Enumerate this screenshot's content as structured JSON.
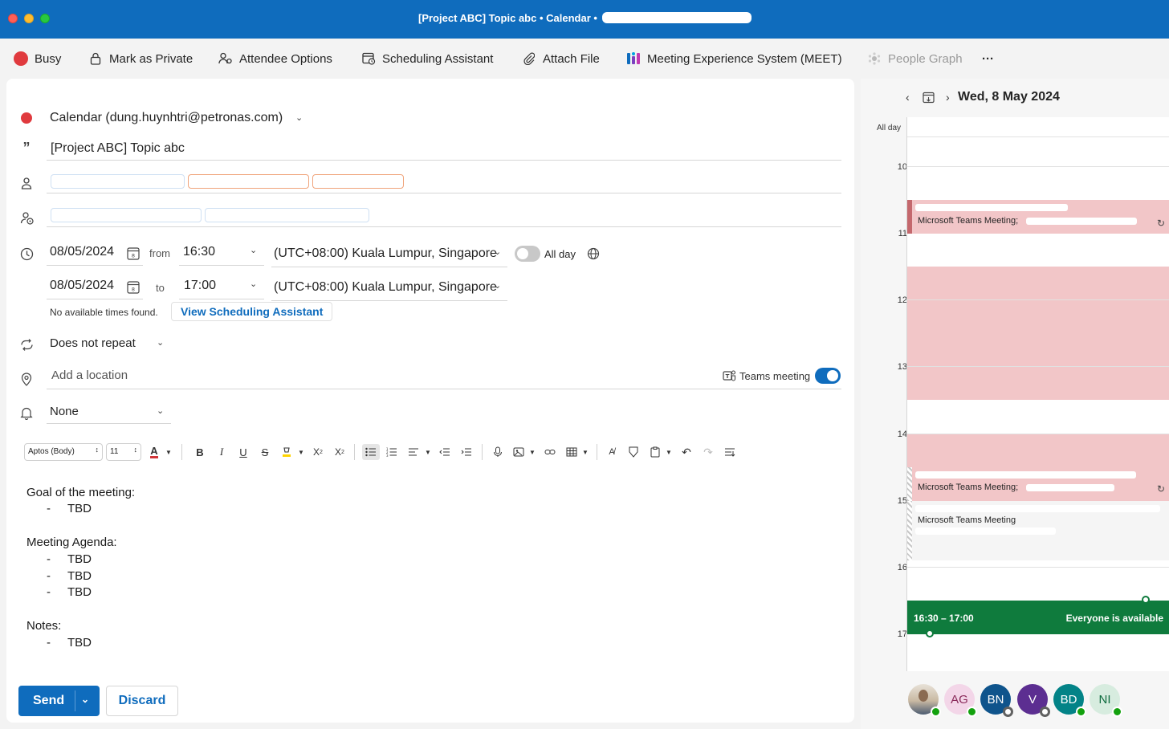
{
  "window": {
    "title": "[Project ABC] Topic abc • Calendar •"
  },
  "toolbar": {
    "busy": "Busy",
    "mark_private": "Mark as Private",
    "attendee_options": "Attendee Options",
    "scheduling_assistant": "Scheduling Assistant",
    "attach_file": "Attach File",
    "meet": "Meeting Experience System (MEET)",
    "people_graph": "People Graph",
    "more": "···"
  },
  "form": {
    "calendar": "Calendar (dung.huynhtri@petronas.com)",
    "title": "[Project ABC] Topic abc",
    "start_date": "08/05/2024",
    "from_label": "from",
    "start_time": "16:30",
    "timezone_start": "(UTC+08:00) Kuala Lumpur, Singapore",
    "all_day_label": "All day",
    "end_date": "08/05/2024",
    "to_label": "to",
    "end_time": "17:00",
    "timezone_end": "(UTC+08:00) Kuala Lumpur, Singapore",
    "no_times": "No available times found.",
    "view_scheduling": "View Scheduling Assistant",
    "repeat": "Does not repeat",
    "location_placeholder": "Add a location",
    "teams_meeting_label": "Teams meeting",
    "teams_meeting_on": true,
    "reminder": "None"
  },
  "format_bar": {
    "font": "Aptos (Body)",
    "size": "11"
  },
  "body": {
    "goal_heading": "Goal of the meeting:",
    "goal_items": [
      "TBD"
    ],
    "agenda_heading": "Meeting Agenda:",
    "agenda_items": [
      "TBD",
      "TBD",
      "TBD"
    ],
    "notes_heading": "Notes:",
    "notes_items": [
      "TBD"
    ],
    "bullet_dash": "-"
  },
  "actions": {
    "send": "Send",
    "discard": "Discard"
  },
  "day_view": {
    "date": "Wed, 8 May 2024",
    "all_day_label": "All day",
    "hours": [
      "10",
      "11",
      "12",
      "13",
      "14",
      "15",
      "16",
      "17"
    ],
    "events": [
      {
        "subtitle": "Microsoft Teams Meeting;"
      },
      {
        "subtitle": "Microsoft Teams Meeting;"
      },
      {
        "subtitle": "Microsoft Teams Meeting"
      }
    ],
    "selection": {
      "time": "16:30 – 17:00",
      "status": "Everyone is available"
    }
  },
  "attendees": [
    {
      "initials": "",
      "type": "photo",
      "presence": "available"
    },
    {
      "initials": "AG",
      "bg": "#f3d6e8",
      "fg": "#8a2a5a",
      "presence": "available"
    },
    {
      "initials": "BN",
      "bg": "#0f548c",
      "fg": "#ffffff",
      "presence": "away"
    },
    {
      "initials": "V",
      "bg": "#5c2e91",
      "fg": "#ffffff",
      "presence": "away"
    },
    {
      "initials": "BD",
      "bg": "#038387",
      "fg": "#ffffff",
      "presence": "available"
    },
    {
      "initials": "NI",
      "bg": "#d7ecdf",
      "fg": "#0e6b3e",
      "presence": "available"
    }
  ],
  "colors": {
    "accent": "#0f6cbd",
    "busy": "#e03a3e",
    "busy_block": "#f2c6c8",
    "available": "#0f7b3d"
  }
}
